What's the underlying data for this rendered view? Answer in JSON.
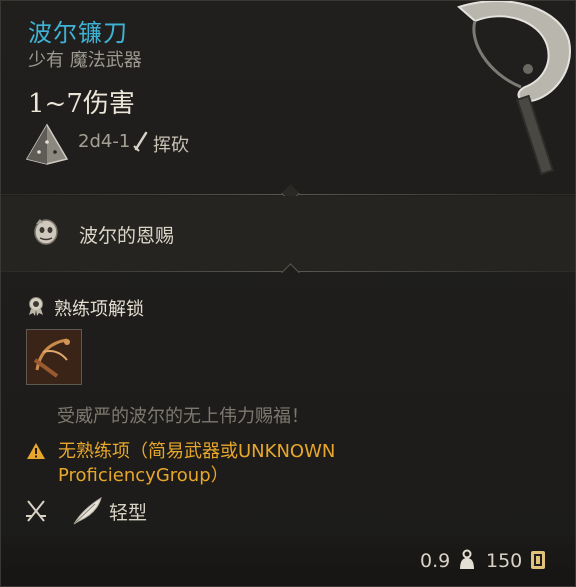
{
  "item": {
    "name": "波尔镰刀",
    "rarity_type": "少有 魔法武器",
    "damage": "1~7伤害",
    "dice": "2d4-1",
    "damage_type": "挥砍"
  },
  "boon": {
    "label": "波尔的恩赐"
  },
  "proficiency": {
    "header": "熟练项解锁",
    "flavor": "受威严的波尔的无上伟力赐福！",
    "warning_line1": "无熟练项（简易武器或UNKNOWN",
    "warning_line2": "ProficiencyGroup）"
  },
  "properties": {
    "light_label": "轻型"
  },
  "footer": {
    "weight": "0.9",
    "price": "150"
  },
  "colors": {
    "title": "#3fb3d6",
    "warning": "#e8a72b",
    "muted": "#9e9a90",
    "background": "#1d1c1a"
  },
  "icons": {
    "dice": "d4-dice-icon",
    "slash": "slash-damage-icon",
    "boon": "boon-mask-icon",
    "proficiency": "proficiency-badge-icon",
    "warning": "warning-triangle-icon",
    "light_weapon": "crossed-swords-icon",
    "feather": "feather-icon",
    "weight": "weight-icon",
    "gold": "gold-coin-icon"
  }
}
